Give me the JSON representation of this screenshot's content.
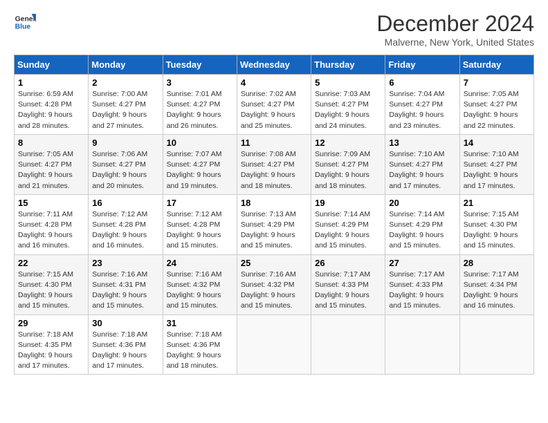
{
  "logo": {
    "line1": "General",
    "line2": "Blue"
  },
  "title": "December 2024",
  "subtitle": "Malverne, New York, United States",
  "days_of_week": [
    "Sunday",
    "Monday",
    "Tuesday",
    "Wednesday",
    "Thursday",
    "Friday",
    "Saturday"
  ],
  "weeks": [
    [
      {
        "day": "1",
        "sunrise": "Sunrise: 6:59 AM",
        "sunset": "Sunset: 4:28 PM",
        "daylight": "Daylight: 9 hours and 28 minutes."
      },
      {
        "day": "2",
        "sunrise": "Sunrise: 7:00 AM",
        "sunset": "Sunset: 4:27 PM",
        "daylight": "Daylight: 9 hours and 27 minutes."
      },
      {
        "day": "3",
        "sunrise": "Sunrise: 7:01 AM",
        "sunset": "Sunset: 4:27 PM",
        "daylight": "Daylight: 9 hours and 26 minutes."
      },
      {
        "day": "4",
        "sunrise": "Sunrise: 7:02 AM",
        "sunset": "Sunset: 4:27 PM",
        "daylight": "Daylight: 9 hours and 25 minutes."
      },
      {
        "day": "5",
        "sunrise": "Sunrise: 7:03 AM",
        "sunset": "Sunset: 4:27 PM",
        "daylight": "Daylight: 9 hours and 24 minutes."
      },
      {
        "day": "6",
        "sunrise": "Sunrise: 7:04 AM",
        "sunset": "Sunset: 4:27 PM",
        "daylight": "Daylight: 9 hours and 23 minutes."
      },
      {
        "day": "7",
        "sunrise": "Sunrise: 7:05 AM",
        "sunset": "Sunset: 4:27 PM",
        "daylight": "Daylight: 9 hours and 22 minutes."
      }
    ],
    [
      {
        "day": "8",
        "sunrise": "Sunrise: 7:05 AM",
        "sunset": "Sunset: 4:27 PM",
        "daylight": "Daylight: 9 hours and 21 minutes."
      },
      {
        "day": "9",
        "sunrise": "Sunrise: 7:06 AM",
        "sunset": "Sunset: 4:27 PM",
        "daylight": "Daylight: 9 hours and 20 minutes."
      },
      {
        "day": "10",
        "sunrise": "Sunrise: 7:07 AM",
        "sunset": "Sunset: 4:27 PM",
        "daylight": "Daylight: 9 hours and 19 minutes."
      },
      {
        "day": "11",
        "sunrise": "Sunrise: 7:08 AM",
        "sunset": "Sunset: 4:27 PM",
        "daylight": "Daylight: 9 hours and 18 minutes."
      },
      {
        "day": "12",
        "sunrise": "Sunrise: 7:09 AM",
        "sunset": "Sunset: 4:27 PM",
        "daylight": "Daylight: 9 hours and 18 minutes."
      },
      {
        "day": "13",
        "sunrise": "Sunrise: 7:10 AM",
        "sunset": "Sunset: 4:27 PM",
        "daylight": "Daylight: 9 hours and 17 minutes."
      },
      {
        "day": "14",
        "sunrise": "Sunrise: 7:10 AM",
        "sunset": "Sunset: 4:27 PM",
        "daylight": "Daylight: 9 hours and 17 minutes."
      }
    ],
    [
      {
        "day": "15",
        "sunrise": "Sunrise: 7:11 AM",
        "sunset": "Sunset: 4:28 PM",
        "daylight": "Daylight: 9 hours and 16 minutes."
      },
      {
        "day": "16",
        "sunrise": "Sunrise: 7:12 AM",
        "sunset": "Sunset: 4:28 PM",
        "daylight": "Daylight: 9 hours and 16 minutes."
      },
      {
        "day": "17",
        "sunrise": "Sunrise: 7:12 AM",
        "sunset": "Sunset: 4:28 PM",
        "daylight": "Daylight: 9 hours and 15 minutes."
      },
      {
        "day": "18",
        "sunrise": "Sunrise: 7:13 AM",
        "sunset": "Sunset: 4:29 PM",
        "daylight": "Daylight: 9 hours and 15 minutes."
      },
      {
        "day": "19",
        "sunrise": "Sunrise: 7:14 AM",
        "sunset": "Sunset: 4:29 PM",
        "daylight": "Daylight: 9 hours and 15 minutes."
      },
      {
        "day": "20",
        "sunrise": "Sunrise: 7:14 AM",
        "sunset": "Sunset: 4:29 PM",
        "daylight": "Daylight: 9 hours and 15 minutes."
      },
      {
        "day": "21",
        "sunrise": "Sunrise: 7:15 AM",
        "sunset": "Sunset: 4:30 PM",
        "daylight": "Daylight: 9 hours and 15 minutes."
      }
    ],
    [
      {
        "day": "22",
        "sunrise": "Sunrise: 7:15 AM",
        "sunset": "Sunset: 4:30 PM",
        "daylight": "Daylight: 9 hours and 15 minutes."
      },
      {
        "day": "23",
        "sunrise": "Sunrise: 7:16 AM",
        "sunset": "Sunset: 4:31 PM",
        "daylight": "Daylight: 9 hours and 15 minutes."
      },
      {
        "day": "24",
        "sunrise": "Sunrise: 7:16 AM",
        "sunset": "Sunset: 4:32 PM",
        "daylight": "Daylight: 9 hours and 15 minutes."
      },
      {
        "day": "25",
        "sunrise": "Sunrise: 7:16 AM",
        "sunset": "Sunset: 4:32 PM",
        "daylight": "Daylight: 9 hours and 15 minutes."
      },
      {
        "day": "26",
        "sunrise": "Sunrise: 7:17 AM",
        "sunset": "Sunset: 4:33 PM",
        "daylight": "Daylight: 9 hours and 15 minutes."
      },
      {
        "day": "27",
        "sunrise": "Sunrise: 7:17 AM",
        "sunset": "Sunset: 4:33 PM",
        "daylight": "Daylight: 9 hours and 15 minutes."
      },
      {
        "day": "28",
        "sunrise": "Sunrise: 7:17 AM",
        "sunset": "Sunset: 4:34 PM",
        "daylight": "Daylight: 9 hours and 16 minutes."
      }
    ],
    [
      {
        "day": "29",
        "sunrise": "Sunrise: 7:18 AM",
        "sunset": "Sunset: 4:35 PM",
        "daylight": "Daylight: 9 hours and 17 minutes."
      },
      {
        "day": "30",
        "sunrise": "Sunrise: 7:18 AM",
        "sunset": "Sunset: 4:36 PM",
        "daylight": "Daylight: 9 hours and 17 minutes."
      },
      {
        "day": "31",
        "sunrise": "Sunrise: 7:18 AM",
        "sunset": "Sunset: 4:36 PM",
        "daylight": "Daylight: 9 hours and 18 minutes."
      },
      null,
      null,
      null,
      null
    ]
  ]
}
